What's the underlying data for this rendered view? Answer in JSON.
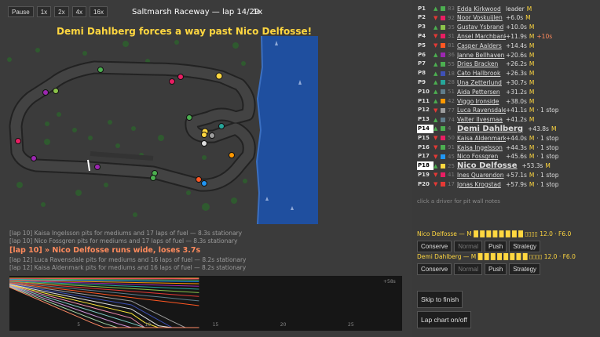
{
  "speed_buttons": [
    "Pause",
    "1x",
    "2x",
    "4x",
    "16x"
  ],
  "race": {
    "title": "Saltmarsh Raceway — lap 14/29",
    "speed": "1x"
  },
  "headline": "Demi Dahlberg forces a way past Nico Delfosse!",
  "events": [
    {
      "text": "[lap 10] Kaisa Ingelsson pits for mediums and 17 laps of fuel — 8.3s stationary",
      "big": false
    },
    {
      "text": "[lap 10] Nico Fossgren pits for mediums and 17 laps of fuel — 8.3s stationary",
      "big": false
    },
    {
      "text": "[lap 10] » Nico Delfosse runs wide, loses 3.7s",
      "big": true
    },
    {
      "text": "[lap 12] Luca Ravensdale pits for mediums and 16 laps of fuel — 8.2s stationary",
      "big": false
    },
    {
      "text": "[lap 12] Kaisa Aldenmark pits for mediums and 16 laps of fuel — 8.2s stationary",
      "big": false
    }
  ],
  "lapchart": {
    "x_ticks": [
      "5",
      "10",
      "15",
      "20",
      "25"
    ],
    "corner_label": "+58s"
  },
  "standings": [
    {
      "pos": "P1",
      "arrow": "▲",
      "dir": "up",
      "color": "#4caf50",
      "num": "83",
      "name": "Edda Kirkwood",
      "gap": "leader",
      "tyre": "M",
      "extra": ""
    },
    {
      "pos": "P2",
      "arrow": "▼",
      "dir": "down",
      "color": "#e91e63",
      "num": "92",
      "name": "Noor Voskuijlen",
      "gap": "+6.0s",
      "tyre": "M",
      "extra": ""
    },
    {
      "pos": "P3",
      "arrow": "▲",
      "dir": "up",
      "color": "#8bc34a",
      "num": "35",
      "name": "Gustav Ysbrand",
      "gap": "+10.0s",
      "tyre": "M",
      "extra": ""
    },
    {
      "pos": "P4",
      "arrow": "▼",
      "dir": "down",
      "color": "#e91e63",
      "num": "31",
      "name": "Ansel Marchbanks",
      "gap": "+11.9s",
      "tyre": "M",
      "extra": "+10s"
    },
    {
      "pos": "P5",
      "arrow": "▼",
      "dir": "down",
      "color": "#ff5722",
      "num": "81",
      "name": "Casper Aalders",
      "gap": "+14.4s",
      "tyre": "M",
      "extra": ""
    },
    {
      "pos": "P6",
      "arrow": "▲",
      "dir": "up",
      "color": "#9c27b0",
      "num": "36",
      "name": "Janne Bellhaven",
      "gap": "+20.6s",
      "tyre": "M",
      "extra": ""
    },
    {
      "pos": "P7",
      "arrow": "▲",
      "dir": "up",
      "color": "#4caf50",
      "num": "55",
      "name": "Dries Bracken",
      "gap": "+26.2s",
      "tyre": "M",
      "extra": ""
    },
    {
      "pos": "P8",
      "arrow": "▲",
      "dir": "up",
      "color": "#3f51b5",
      "num": "18",
      "name": "Cato Hallbrook",
      "gap": "+26.3s",
      "tyre": "M",
      "extra": ""
    },
    {
      "pos": "P9",
      "arrow": "▲",
      "dir": "up",
      "color": "#26a69a",
      "num": "28",
      "name": "Una Zetterlund",
      "gap": "+30.7s",
      "tyre": "M",
      "extra": ""
    },
    {
      "pos": "P10",
      "arrow": "▲",
      "dir": "up",
      "color": "#607d8b",
      "num": "51",
      "name": "Aida Pettersen",
      "gap": "+31.2s",
      "tyre": "M",
      "extra": ""
    },
    {
      "pos": "P11",
      "arrow": "▲",
      "dir": "up",
      "color": "#ff9800",
      "num": "42",
      "name": "Viggo Ironside",
      "gap": "+38.0s",
      "tyre": "M",
      "extra": ""
    },
    {
      "pos": "P12",
      "arrow": "▼",
      "dir": "down",
      "color": "#9e9e9e",
      "num": "77",
      "name": "Luca Ravensdale",
      "gap": "+41.1s",
      "tyre": "M",
      "extra": "· 1 stop"
    },
    {
      "pos": "P13",
      "arrow": "▲",
      "dir": "up",
      "color": "#607d8b",
      "num": "74",
      "name": "Valter Ilvesmaa",
      "gap": "+41.2s",
      "tyre": "M",
      "extra": ""
    },
    {
      "pos": "P14",
      "arrow": "▲",
      "dir": "up",
      "color": "#4caf50",
      "num": "4",
      "name": "Demi Dahlberg",
      "gap": "+43.8s",
      "tyre": "M",
      "extra": "",
      "selected": true,
      "big": true
    },
    {
      "pos": "P15",
      "arrow": "▼",
      "dir": "down",
      "color": "#e91e63",
      "num": "50",
      "name": "Kaisa Aldenmark",
      "gap": "+44.0s",
      "tyre": "M",
      "extra": "· 1 stop"
    },
    {
      "pos": "P16",
      "arrow": "▼",
      "dir": "down",
      "color": "#4caf50",
      "num": "91",
      "name": "Kaisa Ingelsson",
      "gap": "+44.3s",
      "tyre": "M",
      "extra": "· 1 stop"
    },
    {
      "pos": "P17",
      "arrow": "▼",
      "dir": "down",
      "color": "#2196f3",
      "num": "45",
      "name": "Nico Fossgren",
      "gap": "+45.6s",
      "tyre": "M",
      "extra": "· 1 stop"
    },
    {
      "pos": "P18",
      "arrow": "▲",
      "dir": "up",
      "color": "#ffd740",
      "num": "25",
      "name": "Nico Delfosse",
      "gap": "+53.3s",
      "tyre": "M",
      "extra": "",
      "selected": true,
      "big": true
    },
    {
      "pos": "P19",
      "arrow": "▼",
      "dir": "down",
      "color": "#e91e63",
      "num": "41",
      "name": "Ines Quarendon",
      "gap": "+57.1s",
      "tyre": "M",
      "extra": "· 1 stop"
    },
    {
      "pos": "P20",
      "arrow": "▼",
      "dir": "down",
      "color": "#e53935",
      "num": "17",
      "name": "Jonas Krogstad",
      "gap": "+57.9s",
      "tyre": "M",
      "extra": "· 1 stop"
    }
  ],
  "hint": "click a driver for pit wall notes",
  "driver_panels": [
    {
      "name": "Nico Delfosse",
      "tyre": "M",
      "blocks": "█ █ █ █ █ █ █ █ ▯▯▯▯",
      "stats": "12.0 · F6.0",
      "buttons": [
        "Conserve",
        "Normal",
        "Push",
        "Strategy"
      ],
      "dim_index": 1
    },
    {
      "name": "Demi Dahlberg",
      "tyre": "M",
      "blocks": "█ █ █ █ █ █ █ █ ▯▯▯▯",
      "stats": "12.0 · F6.0",
      "buttons": [
        "Conserve",
        "Normal",
        "Push",
        "Strategy"
      ],
      "dim_index": 1
    }
  ],
  "actions": {
    "skip": "Skip to finish",
    "lapchart": "Lap chart on/off"
  }
}
